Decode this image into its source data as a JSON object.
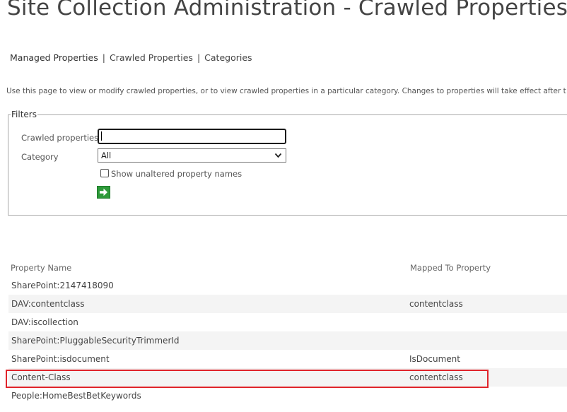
{
  "page": {
    "title": "Site Collection Administration - Crawled Properties"
  },
  "nav": {
    "managed_properties": "Managed Properties",
    "separator": "|",
    "crawled_properties": "Crawled Properties",
    "categories": "Categories"
  },
  "description": "Use this page to view or modify crawled properties, or to view crawled properties in a particular category. Changes to properties will take effect after t",
  "filters": {
    "legend": "Filters",
    "crawled_label": "Crawled properties",
    "crawled_value": "",
    "category_label": "Category",
    "category_value": "All",
    "checkbox_label": "Show unaltered property names",
    "checkbox_checked": false
  },
  "table": {
    "headers": {
      "property_name": "Property Name",
      "mapped_to": "Mapped To Property"
    },
    "rows": [
      {
        "name": "SharePoint:2147418090",
        "mapped": ""
      },
      {
        "name": "DAV:contentclass",
        "mapped": "contentclass"
      },
      {
        "name": "DAV:iscollection",
        "mapped": ""
      },
      {
        "name": "SharePoint:PluggableSecurityTrimmerId",
        "mapped": ""
      },
      {
        "name": "SharePoint:isdocument",
        "mapped": "IsDocument"
      },
      {
        "name": "Content-Class",
        "mapped": "contentclass"
      },
      {
        "name": "People:HomeBestBetKeywords",
        "mapped": ""
      }
    ]
  },
  "colors": {
    "highlight": "#e0242b",
    "go_button": "#2e9a3a",
    "row_alt": "#f4f4f4"
  }
}
